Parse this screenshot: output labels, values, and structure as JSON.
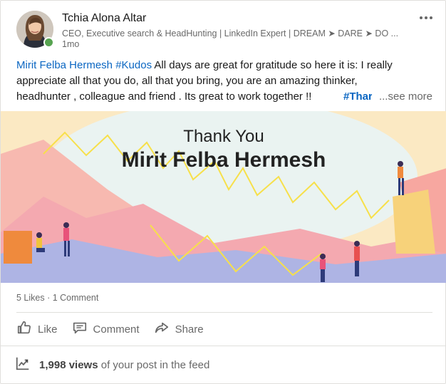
{
  "post": {
    "author": {
      "name": "Tchia Alona Altar",
      "headline": "CEO, Executive search & HeadHunting | LinkedIn Expert | DREAM ➤ DARE ➤ DO ...",
      "time": "1mo"
    },
    "text": {
      "mention": "Mirit Felba Hermesh",
      "hashtag_kudos": "#Kudos",
      "line1_rest": " All days are great for gratitude so here it is: I really",
      "line2": "appreciate all that you do, all that you bring, you are an amazing thinker,",
      "line3": "headhunter , colleague and friend . Its great to work together !!",
      "hashtag_cut": "#Thar",
      "see_more": "...see more"
    },
    "image": {
      "line1": "Thank You",
      "line2": "Mirit Felba Hermesh"
    },
    "social": {
      "likes": "5 Likes",
      "separator": " · ",
      "comments": "1 Comment"
    },
    "actions": {
      "like": "Like",
      "comment": "Comment",
      "share": "Share"
    },
    "analytics": {
      "views": "1,998 views",
      "rest": " of your post in the feed"
    }
  },
  "colors": {
    "link": "#0a66c2",
    "presence": "#57a350",
    "muted": "#00000099"
  },
  "icons": [
    "more-icon",
    "like-icon",
    "comment-icon",
    "share-icon",
    "analytics-icon"
  ]
}
